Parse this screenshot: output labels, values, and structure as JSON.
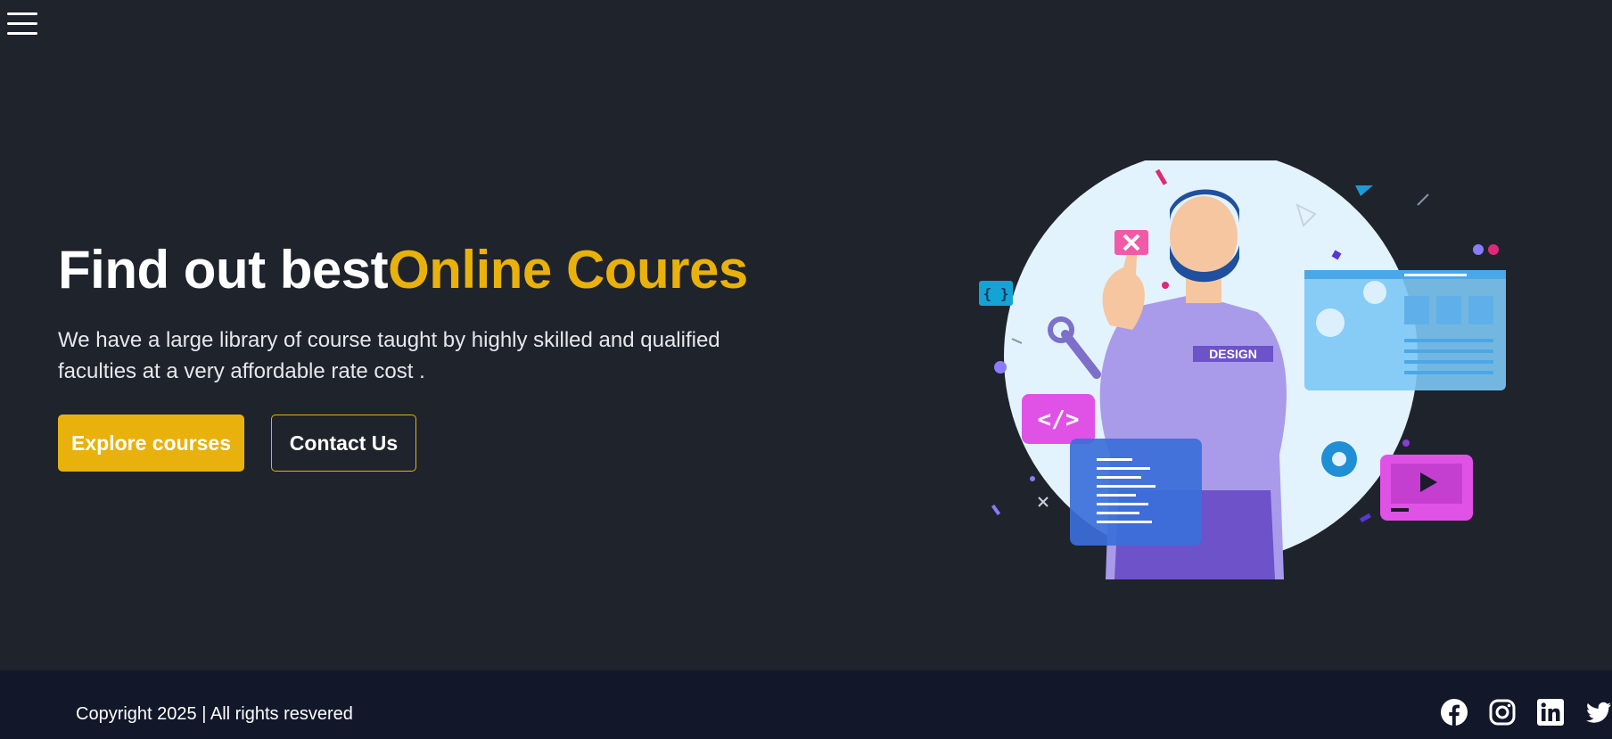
{
  "nav": {
    "menu_icon": "hamburger-menu-icon"
  },
  "hero": {
    "title_plain": "Find out best",
    "title_accent": "Online Coures",
    "description": "We have a large library of course taught by highly skilled and qualified faculties at a very affordable rate cost .",
    "primary_button": "Explore courses",
    "secondary_button": "Contact Us",
    "illustration_badge": "DESIGN"
  },
  "footer": {
    "copyright": "Copyright 2025 | All rights resvered",
    "socials": [
      "facebook-icon",
      "instagram-icon",
      "linkedin-icon",
      "twitter-icon"
    ]
  },
  "colors": {
    "background": "#1f232c",
    "footer_background": "#121829",
    "accent": "#e9b10c",
    "text": "#ffffff"
  }
}
